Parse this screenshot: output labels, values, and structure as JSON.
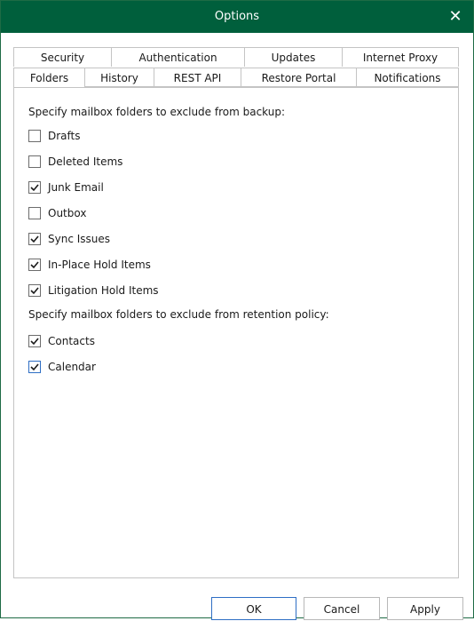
{
  "dialog": {
    "title": "Options",
    "close_glyph": "✕"
  },
  "tabs": {
    "row1": [
      "Security",
      "Authentication",
      "Updates",
      "Internet Proxy"
    ],
    "row2": [
      "Folders",
      "History",
      "REST API",
      "Restore Portal",
      "Notifications"
    ],
    "active": "Folders"
  },
  "folders": {
    "backup_heading": "Specify mailbox folders to exclude from backup:",
    "backup_items": [
      {
        "label": "Drafts",
        "checked": false
      },
      {
        "label": "Deleted Items",
        "checked": false
      },
      {
        "label": "Junk Email",
        "checked": true
      },
      {
        "label": "Outbox",
        "checked": false
      },
      {
        "label": "Sync Issues",
        "checked": true
      },
      {
        "label": "In-Place Hold Items",
        "checked": true
      },
      {
        "label": "Litigation Hold Items",
        "checked": true
      }
    ],
    "retention_heading": "Specify mailbox folders to exclude from retention policy:",
    "retention_items": [
      {
        "label": "Contacts",
        "checked": true
      },
      {
        "label": "Calendar",
        "checked": true
      }
    ]
  },
  "buttons": {
    "ok": "OK",
    "cancel": "Cancel",
    "apply": "Apply"
  },
  "colors": {
    "titlebar": "#005f3c",
    "title_text": "#ffffff",
    "border": "#c4c4c4",
    "focus": "#2e6ec4"
  }
}
